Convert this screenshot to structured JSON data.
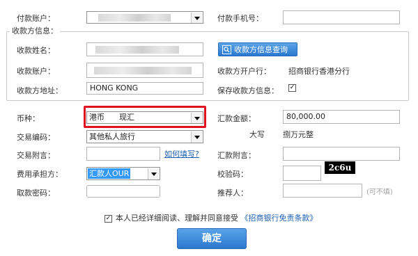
{
  "payer": {
    "account_label": "付款账户：",
    "phone_label": "付款手机号：",
    "phone_value": ""
  },
  "payee_section": {
    "legend": "收款方信息：",
    "name_label": "收款姓名：",
    "name_value": "",
    "query_button": "收款方信息查询",
    "account_label": "收款账户：",
    "account_value": "",
    "bank_label": "收款方开户行：",
    "bank_value": "招商银行香港分行",
    "address_label": "收款方地址：",
    "address_value": "HONG KONG",
    "save_label": "保存收款方信息：",
    "save_checked": "✓"
  },
  "currency": {
    "label": "币种：",
    "value": "港币      现汇"
  },
  "amount": {
    "label": "汇款金额：",
    "value": "80,000.00",
    "daxie_label": "大写",
    "daxie_value": "捌万元整"
  },
  "transaction_code": {
    "label": "交易编码：",
    "value": "其他私人旅行"
  },
  "transaction_note": {
    "label": "交易附言：",
    "value": "",
    "help_link": "如何填写?"
  },
  "remit_note": {
    "label": "汇款附言：",
    "value": ""
  },
  "fee": {
    "label": "费用承担方：",
    "value": "汇款人OUR"
  },
  "captcha": {
    "label": "校验码：",
    "value": "",
    "image_text": "2c6u"
  },
  "pickup_password": {
    "label": "取款密码：",
    "value": ""
  },
  "referrer": {
    "label": "推荐人：",
    "value": "",
    "hint": "(可不填)"
  },
  "agreement": {
    "checked": "✓",
    "text": "本人已经详细阅读、理解并同意接受",
    "link": "《招商银行免责条款》"
  },
  "confirm_button": "确定"
}
